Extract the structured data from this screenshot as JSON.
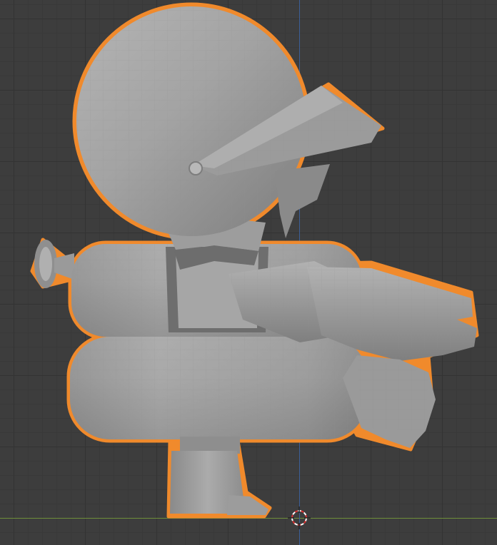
{
  "viewport": {
    "view": "3d-viewport",
    "background_color": "#3d3d3d",
    "grid_color": "#333333",
    "x_axis_color": "#6f8f3a",
    "y_axis_color": "#3c5f98",
    "selection_outline_color": "#f08a2c"
  },
  "object": {
    "selected": true,
    "shading": "solid",
    "mesh_color": "#a4a4a4",
    "parts": [
      "helmet",
      "visor",
      "visor-bolt",
      "neck-collar",
      "torso-ring",
      "inner-tube-ring",
      "arm",
      "glove",
      "lower-glove",
      "leg",
      "foot",
      "side-antenna"
    ]
  },
  "cursor": {
    "icon": "3d-cursor-icon"
  }
}
